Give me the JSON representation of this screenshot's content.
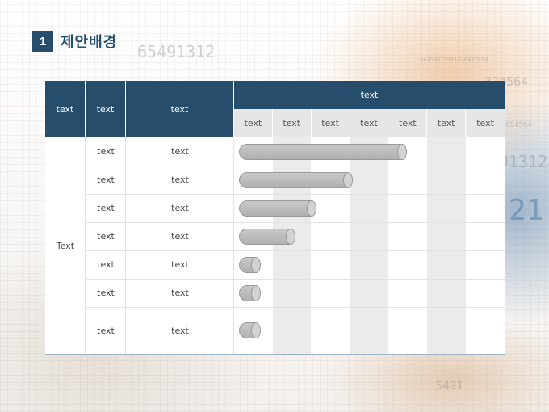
{
  "heading": {
    "number": "1",
    "title": "제안배경"
  },
  "table": {
    "header": {
      "col1": "text",
      "col2": "text",
      "col3": "text",
      "group": "text",
      "sub_columns": [
        "text",
        "text",
        "text",
        "text",
        "text",
        "text",
        "text"
      ]
    },
    "merged_label": "Text",
    "rows": [
      {
        "a": "text",
        "b": "text",
        "progress": 0.94
      },
      {
        "a": "text",
        "b": "text",
        "progress": 0.63
      },
      {
        "a": "text",
        "b": "text",
        "progress": 0.42
      },
      {
        "a": "text",
        "b": "text",
        "progress": 0.3
      },
      {
        "a": "text",
        "b": "text",
        "progress": 0.1
      },
      {
        "a": "text",
        "b": "text",
        "progress": 0.1
      },
      {
        "a": "text",
        "b": "text",
        "progress": 0.1
      }
    ]
  },
  "colors": {
    "header": "#264d6b",
    "subheader": "#e6e6e6",
    "bar": "#b8b8b8"
  }
}
